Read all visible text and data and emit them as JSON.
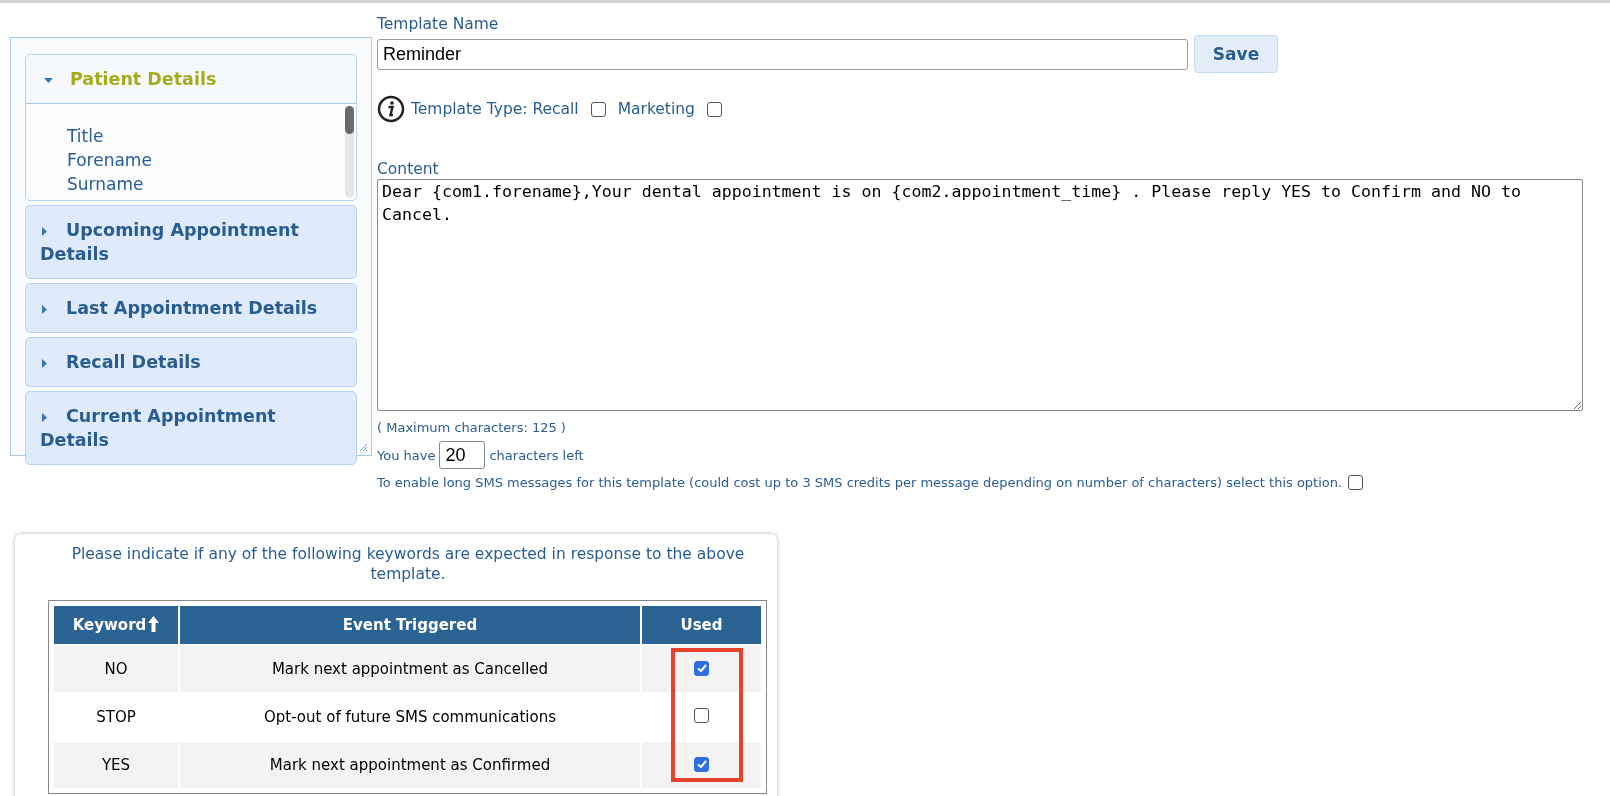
{
  "accordion": {
    "sections": [
      {
        "title": "Patient Details",
        "expanded": true,
        "items": [
          "Title",
          "Forename",
          "Surname"
        ]
      },
      {
        "title": "Upcoming Appointment Details",
        "expanded": false
      },
      {
        "title": "Last Appointment Details",
        "expanded": false
      },
      {
        "title": "Recall Details",
        "expanded": false
      },
      {
        "title": "Current Appointment Details",
        "expanded": false
      }
    ]
  },
  "template_name": {
    "label": "Template Name",
    "value": "Reminder"
  },
  "save_button": "Save",
  "template_type": {
    "label": "Template Type: Recall",
    "recall_checked": false,
    "marketing_label": "Marketing",
    "marketing_checked": false
  },
  "content": {
    "label": "Content",
    "value": "Dear {com1.forename},Your dental appointment is on {com2.appointment_time} . Please reply YES to Confirm and NO to Cancel."
  },
  "max_characters": "( Maximum characters: 125 )",
  "characters_left": {
    "prefix": "You have",
    "value": "20",
    "suffix": "characters left"
  },
  "long_sms": {
    "label": "To enable long SMS messages for this template (could cost up to 3 SMS credits per message depending on number of characters) select this option.",
    "checked": false
  },
  "keywords": {
    "intro": "Please indicate if any of the following keywords are expected in response to the above template.",
    "columns": [
      "Keyword",
      "Event Triggered",
      "Used"
    ],
    "used_highlighted": true,
    "rows": [
      {
        "keyword": "NO",
        "event": "Mark next appointment as Cancelled",
        "used": true
      },
      {
        "keyword": "STOP",
        "event": "Opt-out of future SMS communications",
        "used": false
      },
      {
        "keyword": "YES",
        "event": "Mark next appointment as Confirmed",
        "used": true
      }
    ]
  }
}
